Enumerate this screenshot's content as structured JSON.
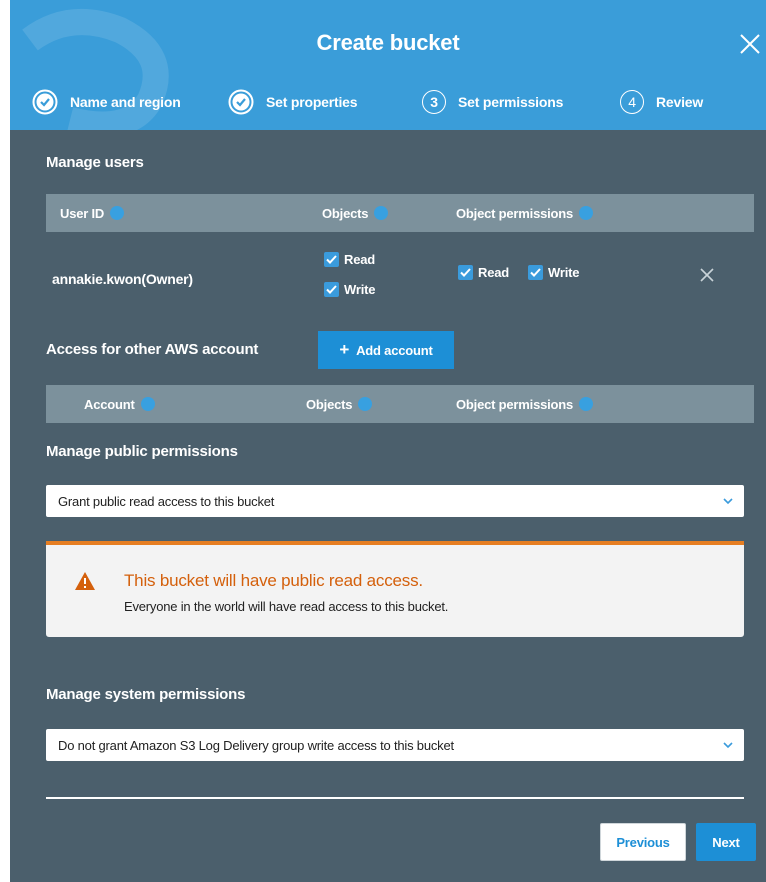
{
  "dialog": {
    "title": "Create bucket"
  },
  "steps": [
    {
      "label": "Name and region",
      "state": "done"
    },
    {
      "label": "Set properties",
      "state": "done"
    },
    {
      "label": "Set permissions",
      "number": "3",
      "state": "active"
    },
    {
      "label": "Review",
      "number": "4",
      "state": "pending"
    }
  ],
  "manage_users": {
    "title": "Manage users",
    "headers": {
      "user_id": "User ID",
      "objects": "Objects",
      "object_permissions": "Object permissions"
    },
    "rows": [
      {
        "user": "annakie.kwon(Owner)",
        "objects": {
          "read": "Read",
          "write": "Write"
        },
        "object_permissions": {
          "read": "Read",
          "write": "Write"
        }
      }
    ]
  },
  "other_accounts": {
    "title": "Access for other AWS account",
    "add_button": "Add account",
    "add_icon": "+",
    "headers": {
      "account": "Account",
      "objects": "Objects",
      "object_permissions": "Object permissions"
    }
  },
  "public_permissions": {
    "title": "Manage public permissions",
    "selected": "Grant public read access to this bucket"
  },
  "alert": {
    "title": "This bucket will have public read access.",
    "message": "Everyone in the world will have read access to this bucket."
  },
  "system_permissions": {
    "title": "Manage system permissions",
    "selected": "Do not grant Amazon S3 Log Delivery group write access to this bucket"
  },
  "footer": {
    "previous": "Previous",
    "next": "Next"
  },
  "colors": {
    "header": "#3a9dd9",
    "body": "#4b5f6c",
    "accent": "#1d8fd6",
    "warning": "#e67e22"
  }
}
